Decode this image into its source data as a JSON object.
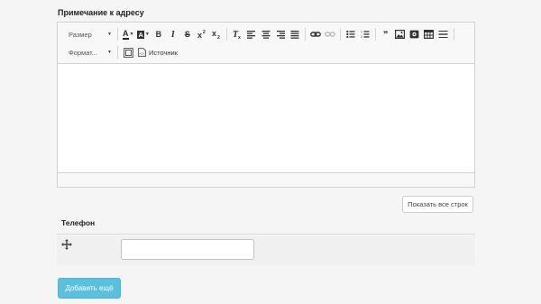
{
  "field": {
    "label": "Примечание к адресу"
  },
  "toolbar": {
    "size_label": "Размер",
    "format_label": "Формат...",
    "source_label": "Источник",
    "bold_glyph": "B",
    "italic_glyph": "I",
    "strike_glyph": "S",
    "text_color_glyph": "A",
    "bg_color_glyph": "A",
    "quote_glyph": "❞"
  },
  "editor": {
    "content": ""
  },
  "show_rows_button": {
    "label": "Показать все строк"
  },
  "phone_section": {
    "title": "Телефон",
    "input_value": "",
    "input_placeholder": ""
  },
  "add_more_button": {
    "label": "Добавить ещё"
  },
  "colors": {
    "accent": "#5bc0de",
    "background": "#f5f5f5",
    "border": "#d1d1d1"
  }
}
